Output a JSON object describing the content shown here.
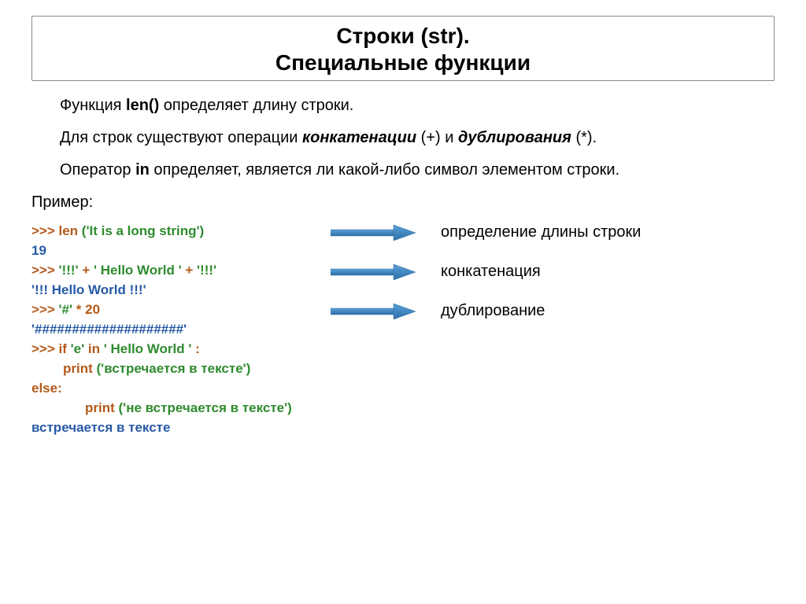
{
  "title_line1": "Строки (str).",
  "title_line2": "Специальные функции",
  "para1_a": "Функция ",
  "para1_b": "len()",
  "para1_c": " определяет длину строки.",
  "para2_a": "Для строк существуют операции ",
  "para2_b": "конкатенации",
  "para2_c": " (+) и ",
  "para2_d": "дублирования",
  "para2_e": " (*).",
  "para3_a": "Оператор ",
  "para3_b": "in",
  "para3_c": " определяет, является ли какой-либо символ элементом строки.",
  "example_label": "Пример:",
  "code_lines": {
    "l1_a": ">>> len ",
    "l1_b": "('It is a long string')",
    "l2": "19",
    "l3_a": ">>> ",
    "l3_b": "'!!!' ",
    "l3_c": "+ ",
    "l3_d": "' Hello World ' ",
    "l3_e": "+ ",
    "l3_f": "'!!!'",
    "l4": "'!!! Hello World !!!'",
    "l5_a": ">>> ",
    "l5_b": "'#' ",
    "l5_c": "* 20",
    "l6": "'####################'",
    "l7_a": ">>> if  ",
    "l7_b": "'e'  ",
    "l7_c": "in  ",
    "l7_d": "' Hello World ' ",
    "l7_e": ":",
    "l8_a": "print ",
    "l8_b": "('встречается в тексте')",
    "l9": "else:",
    "l10_a": "print ",
    "l10_b": "('не встречается в тексте')",
    "l11": "встречается в тексте"
  },
  "notes": {
    "n1": "определение длины строки",
    "n2": "конкатенация",
    "n3": "дублирование"
  }
}
